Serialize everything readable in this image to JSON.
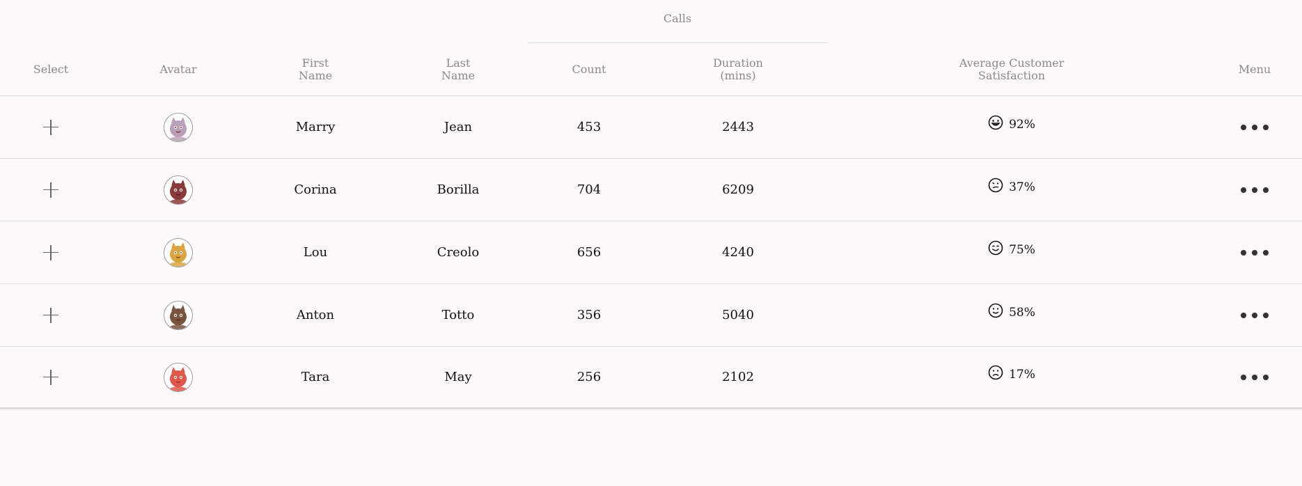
{
  "table": {
    "group_header": "Calls",
    "columns": {
      "select": "Select",
      "avatar": "Avatar",
      "first_name": "First\nName",
      "last_name": "Last\nName",
      "count": "Count",
      "duration": "Duration\n(mins)",
      "satisfaction": "Average Customer\nSatisfaction",
      "menu": "Menu"
    },
    "rows": [
      {
        "first_name": "Marry",
        "last_name": "Jean",
        "count": "453",
        "duration": "2443",
        "satisfaction": "92%",
        "emoji": "laughing-face-icon",
        "avatar_color": "#b9a0b8",
        "avatar_accent": "#8e1b2c"
      },
      {
        "first_name": "Corina",
        "last_name": "Borilla",
        "count": "704",
        "duration": "6209",
        "satisfaction": "37%",
        "emoji": "confused-face-icon",
        "avatar_color": "#8a3a3a",
        "avatar_accent": "#5a1d1d"
      },
      {
        "first_name": "Lou",
        "last_name": "Creolo",
        "count": "656",
        "duration": "4240",
        "satisfaction": "75%",
        "emoji": "smiling-face-icon",
        "avatar_color": "#d9a441",
        "avatar_accent": "#6b4a12"
      },
      {
        "first_name": "Anton",
        "last_name": "Totto",
        "count": "356",
        "duration": "5040",
        "satisfaction": "58%",
        "emoji": "slight-smile-face-icon",
        "avatar_color": "#7a5240",
        "avatar_accent": "#3f2518"
      },
      {
        "first_name": "Tara",
        "last_name": "May",
        "count": "256",
        "duration": "2102",
        "satisfaction": "17%",
        "emoji": "frowning-face-icon",
        "avatar_color": "#e0584a",
        "avatar_accent": "#9b2a1f"
      }
    ]
  }
}
